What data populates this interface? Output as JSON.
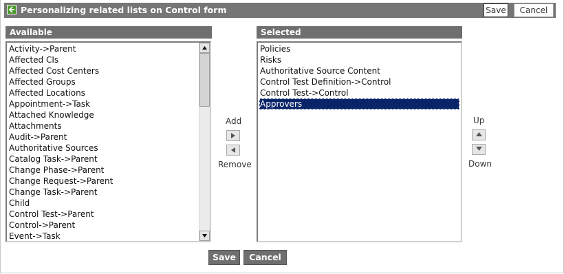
{
  "header": {
    "title": "Personalizing related lists on Control form",
    "back_icon": "back-arrow-icon",
    "save_label": "Save",
    "cancel_label": "Cancel"
  },
  "available": {
    "heading": "Available",
    "items": [
      "Activity->Parent",
      "Affected CIs",
      "Affected Cost Centers",
      "Affected Groups",
      "Affected Locations",
      "Appointment->Task",
      "Attached Knowledge",
      "Attachments",
      "Audit->Parent",
      "Authoritative Sources",
      "Catalog Task->Parent",
      "Change Phase->Parent",
      "Change Request->Parent",
      "Change Task->Parent",
      "Child",
      "Control Test->Parent",
      "Control->Parent",
      "Event->Task"
    ]
  },
  "selected": {
    "heading": "Selected",
    "items": [
      "Policies",
      "Risks",
      "Authoritative Source Content",
      "Control Test Definition->Control",
      "Control Test->Control",
      "Approvers"
    ],
    "highlighted_item": "Approvers"
  },
  "transfer": {
    "add_label": "Add",
    "remove_label": "Remove",
    "add_icon": "arrow-right-icon",
    "remove_icon": "arrow-left-icon"
  },
  "order": {
    "up_label": "Up",
    "down_label": "Down",
    "up_icon": "arrow-up-icon",
    "down_icon": "arrow-down-icon"
  },
  "footer": {
    "save_label": "Save",
    "cancel_label": "Cancel"
  },
  "colors": {
    "title_bar": "#767676",
    "column_header": "#6f6f6f",
    "selection": "#0a246a",
    "back_icon": "#4a9a2a"
  }
}
